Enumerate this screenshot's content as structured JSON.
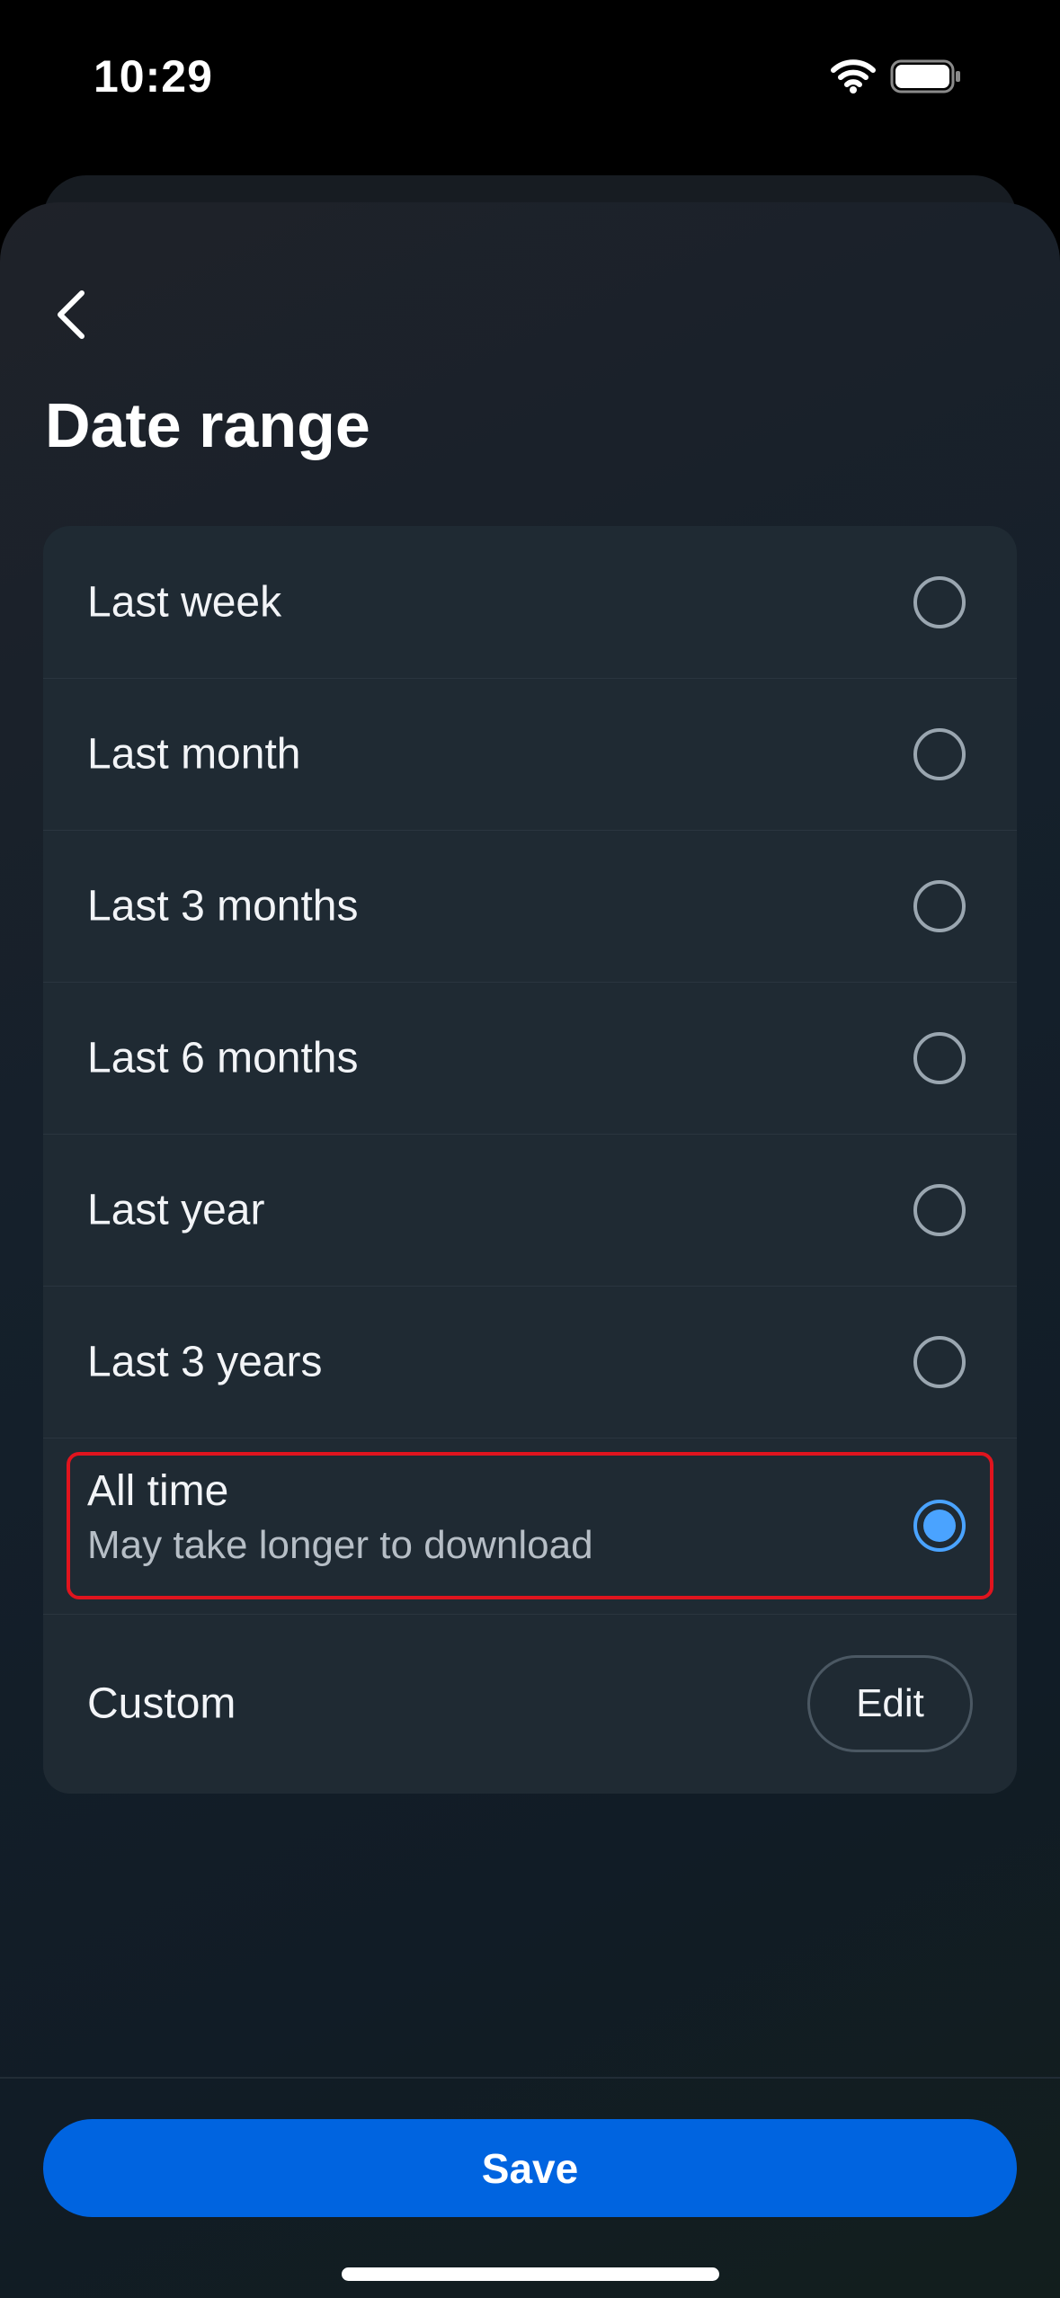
{
  "status_bar": {
    "time": "10:29",
    "icons": [
      "wifi-icon",
      "battery-icon"
    ]
  },
  "header": {
    "back_icon": "chevron-left-icon",
    "title": "Date range"
  },
  "options": [
    {
      "label": "Last week",
      "selected": false
    },
    {
      "label": "Last month",
      "selected": false
    },
    {
      "label": "Last 3 months",
      "selected": false
    },
    {
      "label": "Last 6 months",
      "selected": false
    },
    {
      "label": "Last year",
      "selected": false
    },
    {
      "label": "Last 3 years",
      "selected": false
    },
    {
      "label": "All time",
      "sublabel": "May take longer to download",
      "selected": true,
      "highlighted": true
    }
  ],
  "custom": {
    "label": "Custom",
    "edit_label": "Edit"
  },
  "footer": {
    "save_label": "Save"
  },
  "colors": {
    "accent": "#0064e0",
    "radio_selected": "#4aa3ff",
    "highlight": "#e0141e",
    "card": "#1f2a33"
  }
}
